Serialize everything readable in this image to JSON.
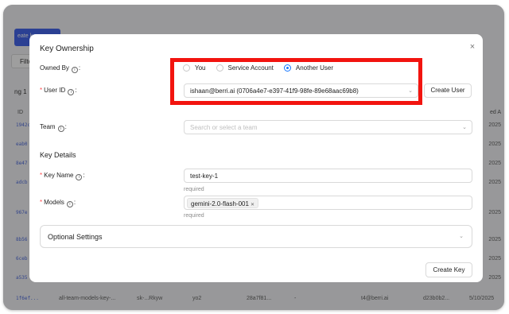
{
  "background": {
    "create_button": "eate k",
    "filter_label": "Filte",
    "page_text": "ng 1",
    "id_header": "ID",
    "created_header": "ed A",
    "row_ids": [
      "1942c",
      "eab0",
      "8e47",
      "adcb",
      "967e",
      "8b56",
      "6ceb",
      "a535"
    ],
    "row_dates": [
      "2025",
      "2025",
      "2025",
      "2025",
      "2025",
      "2025",
      "2025",
      "2025"
    ],
    "last_row": {
      "id": "1f6ef...",
      "name": "all-team-models-key-...",
      "key": "sk-...Rkyw",
      "alias": "yo2",
      "hash": "28a7f81...",
      "dash": "-",
      "email": "t4@berri.ai",
      "short": "d23b0b2...",
      "date": "5/10/2025"
    }
  },
  "modal": {
    "title": "Key Ownership",
    "close_glyph": "×",
    "owned_by": {
      "label": "Owned By",
      "options": [
        "You",
        "Service Account",
        "Another User"
      ],
      "selected": "Another User"
    },
    "user_id": {
      "label": "User ID",
      "value": "ishaan@berri.ai (0706a4e7-e397-41f9-98fe-89e68aac69b8)",
      "button": "Create User"
    },
    "team": {
      "label": "Team",
      "placeholder": "Search or select a team"
    },
    "key_details": {
      "heading": "Key Details",
      "key_name": {
        "label": "Key Name",
        "value": "test-key-1",
        "hint": "required"
      },
      "models": {
        "label": "Models",
        "tag": "gemini-2.0-flash-001",
        "hint": "required"
      }
    },
    "optional_settings": "Optional Settings",
    "create_key_button": "Create Key"
  },
  "colors": {
    "primary": "#1677ff",
    "highlight": "#f2140f",
    "required": "#ff4d4f",
    "link": "#3b5bdb"
  }
}
